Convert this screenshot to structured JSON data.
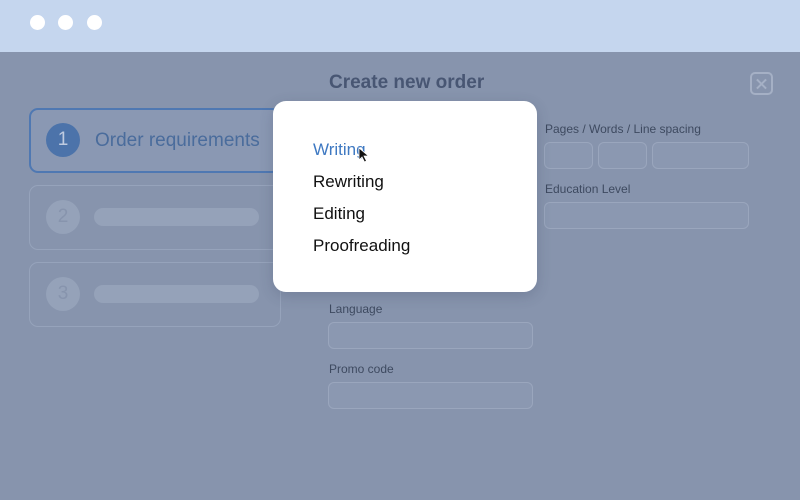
{
  "window": {
    "controls": [
      "dot",
      "dot",
      "dot"
    ]
  },
  "modal": {
    "title": "Create new order"
  },
  "steps": [
    {
      "number": "1",
      "label": "Order requirements",
      "active": true
    },
    {
      "number": "2",
      "label": "",
      "active": false
    },
    {
      "number": "3",
      "label": "",
      "active": false
    }
  ],
  "fields": {
    "pages_label": "Pages / Words / Line spacing",
    "education_label": "Education Level",
    "language_label": "Language",
    "promo_label": "Promo code"
  },
  "dropdown": {
    "options": [
      "Writing",
      "Rewriting",
      "Editing",
      "Proofreading"
    ],
    "selected": "Writing"
  },
  "colors": {
    "accent": "#3f79c2",
    "overlay": "#8794ad",
    "titlebar": "#c5d6ee"
  },
  "icons": [
    "close-icon",
    "us-flag-icon",
    "mouse-cursor-icon"
  ]
}
